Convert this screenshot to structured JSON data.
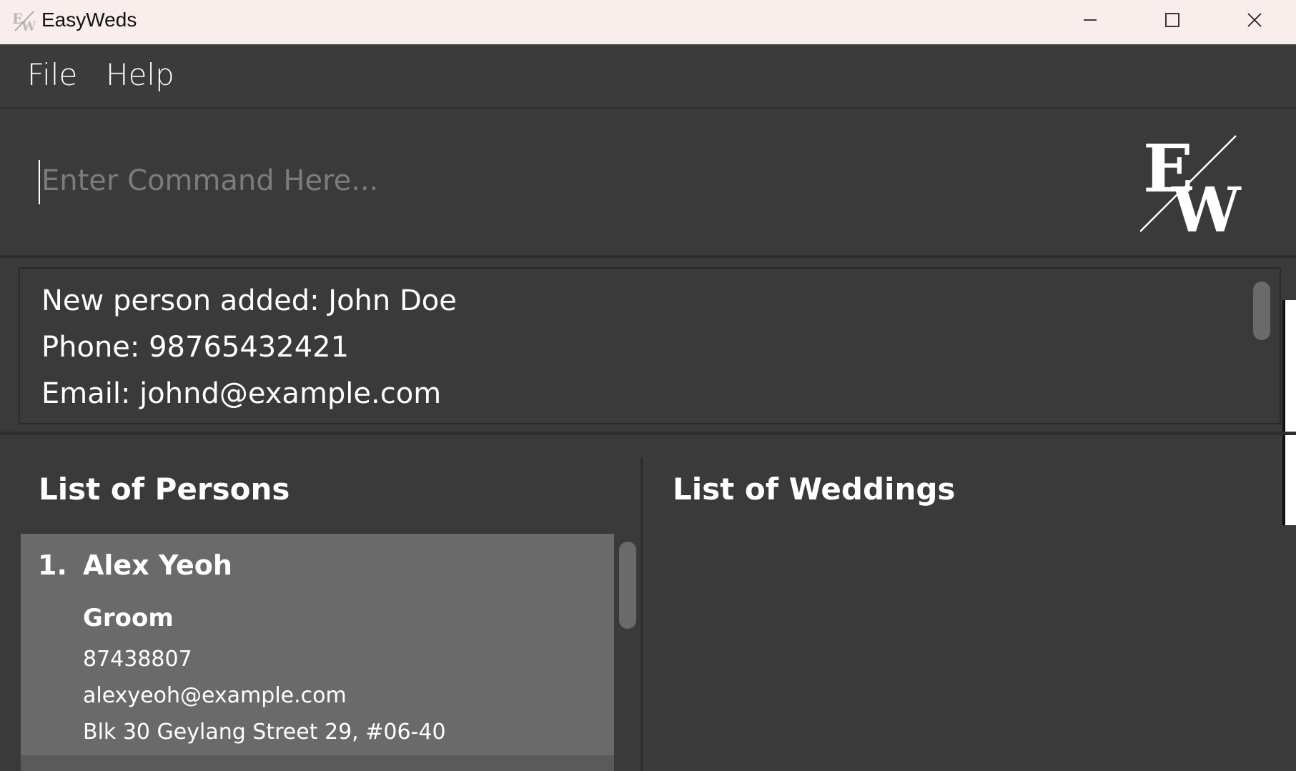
{
  "window": {
    "title": "EasyWeds",
    "icon": "ew-logo-icon",
    "controls": [
      "minimize-icon",
      "maximize-icon",
      "close-icon"
    ]
  },
  "menu": {
    "file": "File",
    "help": "Help"
  },
  "command": {
    "placeholder": "Enter Command Here...",
    "value": ""
  },
  "result": {
    "lines": [
      "New person added: John Doe",
      "Phone: 98765432421",
      "Email: johnd@example.com"
    ]
  },
  "persons": {
    "title": "List of Persons",
    "items": [
      {
        "index": "1.",
        "name": "Alex Yeoh",
        "role": "Groom",
        "phone": "87438807",
        "email": "alexyeoh@example.com",
        "address": "Blk 30 Geylang Street 29, #06-40"
      }
    ]
  },
  "weddings": {
    "title": "List of Weddings",
    "items": []
  },
  "colors": {
    "background": "#3a3a3a",
    "titlebar": "#f9eeec",
    "card": "#6a6a6a",
    "text": "#ffffff",
    "placeholder": "#7c7c7c"
  }
}
